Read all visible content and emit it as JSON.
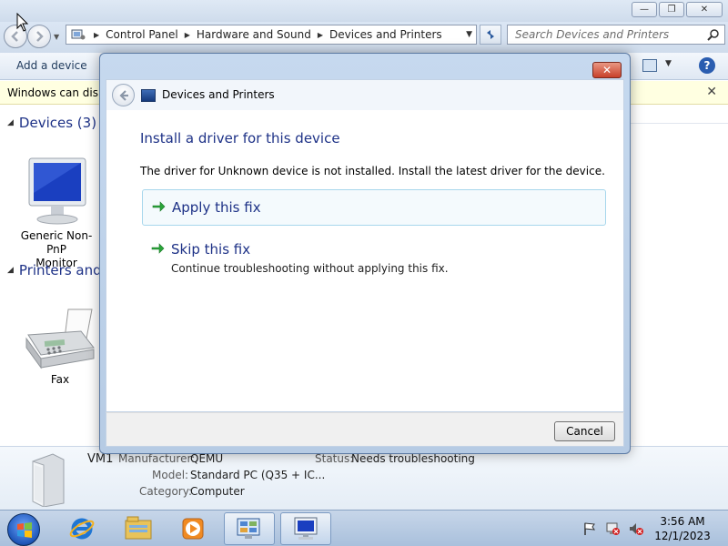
{
  "window": {
    "controls": {
      "minimize": "—",
      "maximize": "❐",
      "close": "✕"
    }
  },
  "address": {
    "crumbs": [
      "Control Panel",
      "Hardware and Sound",
      "Devices and Printers"
    ]
  },
  "search": {
    "placeholder": "Search Devices and Printers"
  },
  "toolbar": {
    "add_device": "Add a device",
    "help": "?"
  },
  "infobar": {
    "text": "Windows can display enhanced device icons and information from the Internet. Click to change...",
    "close": "✕"
  },
  "groups": {
    "devices": {
      "label": "Devices (3)",
      "items": [
        {
          "name": "Generic Non-PnP\nMonitor",
          "icon": "monitor-icon"
        }
      ]
    },
    "printers": {
      "label": "Printers and Faxes",
      "items": [
        {
          "name": "Fax",
          "icon": "fax-icon"
        }
      ]
    }
  },
  "details": {
    "name": "VM1",
    "manufacturer_label": "Manufacturer:",
    "manufacturer_value": "QEMU",
    "model_label": "Model:",
    "model_value": "Standard PC (Q35 + IC...",
    "category_label": "Category:",
    "category_value": "Computer",
    "status_label": "Status:",
    "status_value": "Needs troubleshooting"
  },
  "dialog": {
    "title": "Devices and Printers",
    "close": "✕",
    "heading": "Install a driver for this device",
    "description": "The driver for Unknown device is not installed. Install the latest driver for the device.",
    "options": [
      {
        "title": "Apply this fix",
        "description": ""
      },
      {
        "title": "Skip this fix",
        "description": "Continue troubleshooting without applying this fix."
      }
    ],
    "cancel": "Cancel"
  },
  "taskbar": {
    "apps": [
      "start-orb",
      "internet-explorer-icon",
      "windows-explorer-icon",
      "media-player-icon",
      "control-panel-icon",
      "devices-printers-icon"
    ],
    "time": "3:56 AM",
    "date": "12/1/2023"
  },
  "colors": {
    "accent_blue": "#1e3287",
    "fix_arrow_green": "#2aa53a",
    "infobar_bg": "#ffffe1"
  }
}
